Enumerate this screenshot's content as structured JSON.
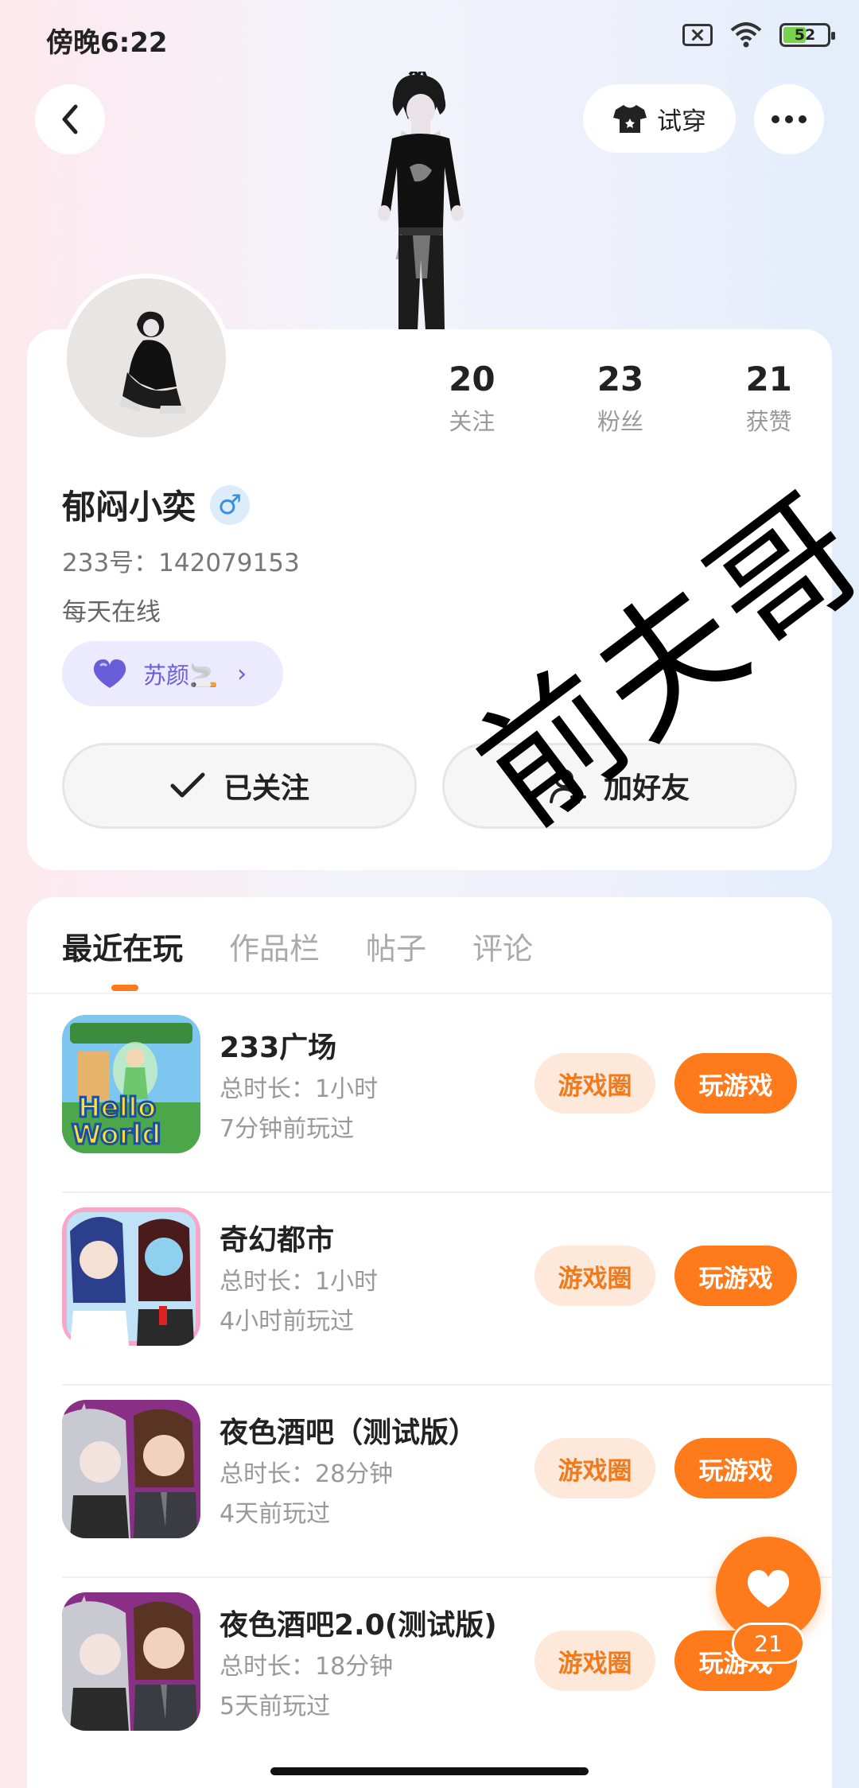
{
  "status_bar": {
    "time": "傍晚6:22",
    "battery": "52",
    "battery_level_percent": 52
  },
  "header": {
    "tryon_label": "试穿"
  },
  "profile": {
    "stats": [
      {
        "num": "20",
        "label": "关注"
      },
      {
        "num": "23",
        "label": "粉丝"
      },
      {
        "num": "21",
        "label": "获赞"
      }
    ],
    "nickname": "郁闷小奕",
    "gender_symbol": "♂",
    "user_id": "233号：142079153",
    "signature": "每天在线",
    "cp_tag": "苏颜🚬",
    "follow_label": "已关注",
    "add_friend_label": "加好友"
  },
  "watermark": "前夫哥",
  "tabs": [
    {
      "label": "最近在玩",
      "active": true
    },
    {
      "label": "作品栏",
      "active": false
    },
    {
      "label": "帖子",
      "active": false
    },
    {
      "label": "评论",
      "active": false
    }
  ],
  "games": [
    {
      "title": "233广场",
      "duration": "总时长：1小时",
      "last_played": "7分钟前玩过",
      "circle_label": "游戏圈",
      "play_label": "玩游戏"
    },
    {
      "title": "奇幻都市",
      "duration": "总时长：1小时",
      "last_played": "4小时前玩过",
      "circle_label": "游戏圈",
      "play_label": "玩游戏"
    },
    {
      "title": "夜色酒吧（测试版）",
      "duration": "总时长：28分钟",
      "last_played": "4天前玩过",
      "circle_label": "游戏圈",
      "play_label": "玩游戏"
    },
    {
      "title": "夜色酒吧2.0(测试版)",
      "duration": "总时长：18分钟",
      "last_played": "5天前玩过",
      "circle_label": "游戏圈",
      "play_label": "玩游戏"
    }
  ],
  "like": {
    "count": "21"
  },
  "colors": {
    "accent": "#ff7a1a",
    "circle_bg": "#fde8da",
    "cp_bg": "#eceaff",
    "cp_text": "#6a5ed8"
  }
}
